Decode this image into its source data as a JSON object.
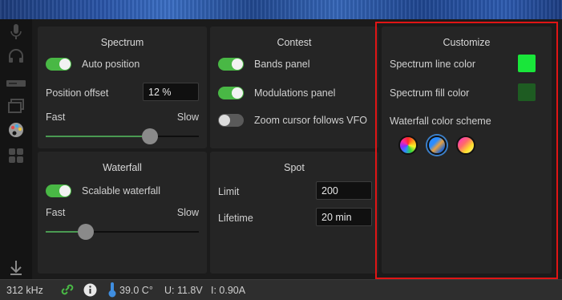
{
  "spectrum": {
    "title": "Spectrum",
    "auto_position_label": "Auto position",
    "auto_position_on": true,
    "position_offset_label": "Position offset",
    "position_offset_value": "12 %",
    "speed_fast_label": "Fast",
    "speed_slow_label": "Slow",
    "speed_slider_level": 0.68
  },
  "contest": {
    "title": "Contest",
    "bands_panel_label": "Bands panel",
    "bands_panel_on": true,
    "modulations_panel_label": "Modulations panel",
    "modulations_panel_on": true,
    "zoom_cursor_label": "Zoom cursor follows VFO",
    "zoom_cursor_on": false
  },
  "customize": {
    "title": "Customize",
    "line_color_label": "Spectrum line color",
    "line_color": "#19e63a",
    "fill_color_label": "Spectrum fill color",
    "fill_color": "#1e5c22",
    "waterfall_scheme_label": "Waterfall color scheme",
    "schemes": [
      "rainbow-scheme",
      "blue-orange-scheme",
      "magenta-yellow-scheme"
    ]
  },
  "waterfall": {
    "title": "Waterfall",
    "scalable_label": "Scalable waterfall",
    "scalable_on": true,
    "speed_fast_label": "Fast",
    "speed_slow_label": "Slow",
    "speed_slider_level": 0.26
  },
  "spot": {
    "title": "Spot",
    "limit_label": "Limit",
    "limit_value": "200",
    "lifetime_label": "Lifetime",
    "lifetime_value": "20 min"
  },
  "sidebar": {
    "icons": [
      "microphone-icon",
      "headphones-icon",
      "radio-icon",
      "windows-icon",
      "palette-icon",
      "grid-icon",
      "down-arrow-icon"
    ]
  },
  "status_bar": {
    "bandwidth": "312 kHz",
    "temperature": "39.0 C°",
    "voltage": "U: 11.8V",
    "current": "I: 0.90A"
  },
  "colors": {
    "accent_green": "#49b845",
    "highlight_red": "#e01515"
  }
}
